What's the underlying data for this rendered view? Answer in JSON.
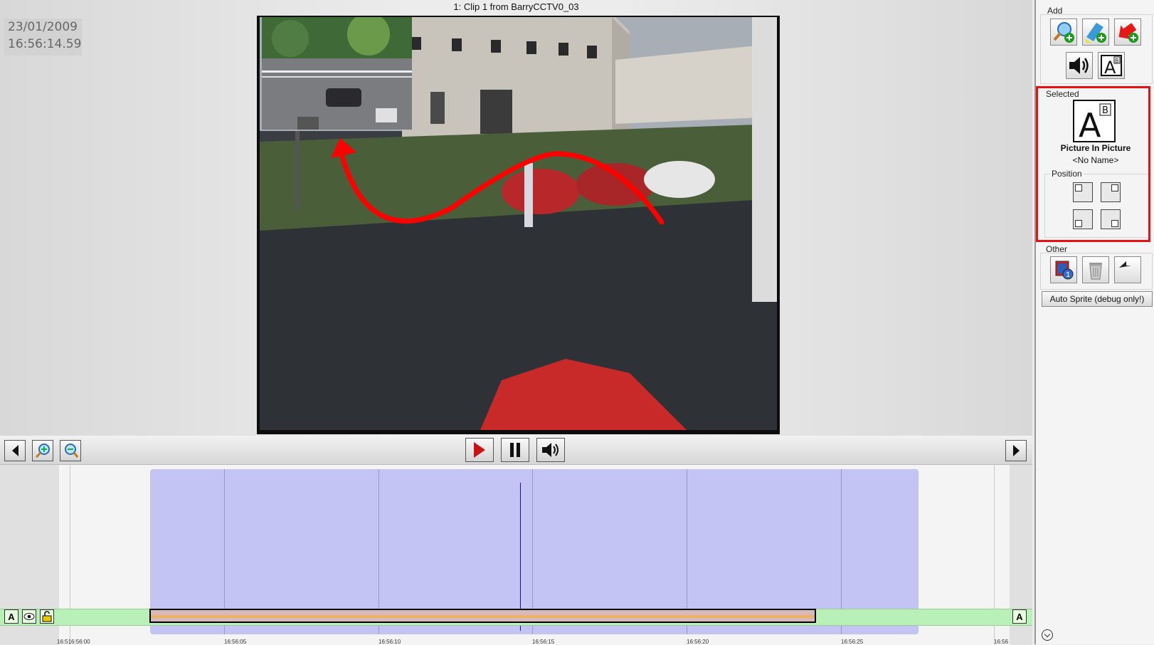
{
  "window": {
    "title": "1: Clip 1 from BarryCCTV0_03"
  },
  "overlay": {
    "date": "23/01/2009",
    "time": "16:56:14.59"
  },
  "playback": {
    "state": "paused",
    "controls": [
      "play",
      "pause",
      "volume"
    ]
  },
  "timeline": {
    "tick_labels": [
      "16:516:56:00",
      "16:56:05",
      "16:56:10",
      "16:56:15",
      "16:56:20",
      "16:56:25",
      "16:56"
    ]
  },
  "panel": {
    "add": {
      "label": "Add",
      "icons": [
        "zoom-add-icon",
        "highlight-add-icon",
        "arrow-add-icon",
        "audio-icon",
        "text-icon"
      ]
    },
    "selected": {
      "label": "Selected",
      "item_type": "Picture In Picture",
      "item_name": "<No Name>",
      "position_label": "Position",
      "positions": [
        "top-left",
        "top-right",
        "bottom-left",
        "bottom-right"
      ]
    },
    "other": {
      "label": "Other",
      "icons": [
        "sequence-icon",
        "trash-icon",
        "undo-icon"
      ]
    },
    "auto_sprite_label": "Auto Sprite (debug only!)"
  },
  "colors": {
    "highlight": "#e81010",
    "range": "#c4c4f4",
    "track": "#b8f0b8",
    "playhead": "#1010e0"
  }
}
